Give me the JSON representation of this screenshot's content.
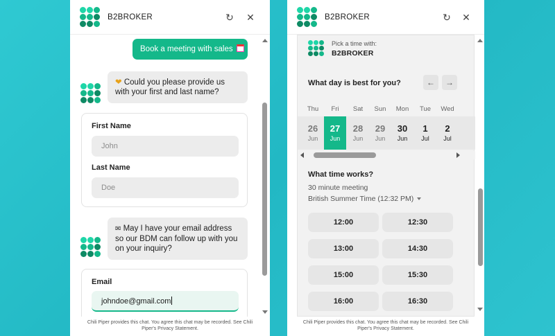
{
  "brand": {
    "name": "B2BROKER",
    "accent": "#14b88a",
    "logo_colors": [
      "#1fd6a8",
      "#14b88a",
      "#0e8a64"
    ]
  },
  "left_panel": {
    "header_title": "B2BROKER",
    "refresh_icon": "refresh-icon",
    "close_icon": "close-icon",
    "user_message": "Book a meeting with sales",
    "user_message_emoji": "calendar-icon",
    "bot_message_1": "Could you please provide us with your first and last name?",
    "bot_message_1_emoji": "heart-icon",
    "first_name_label": "First Name",
    "first_name_placeholder": "John",
    "last_name_label": "Last Name",
    "last_name_placeholder": "Doe",
    "bot_message_2": "May I have your email address so our BDM can follow up with you on your inquiry?",
    "bot_message_2_emoji": "envelope-icon",
    "email_label": "Email",
    "email_value": "johndoe@gmail.com",
    "footer": "Chili Piper provides this chat. You agree this chat may be recorded. See Chili Piper's Privacy Statement."
  },
  "right_panel": {
    "header_title": "B2BROKER",
    "pick_label": "Pick a time with:",
    "pick_name": "B2BROKER",
    "day_question": "What day is best for you?",
    "prev_icon": "arrow-left-icon",
    "next_icon": "arrow-right-icon",
    "days": [
      {
        "weekday": "Thu",
        "date": "26",
        "month": "Jun",
        "state": "disabled"
      },
      {
        "weekday": "Fri",
        "date": "27",
        "month": "Jun",
        "state": "selected"
      },
      {
        "weekday": "Sat",
        "date": "28",
        "month": "Jun",
        "state": "disabled"
      },
      {
        "weekday": "Sun",
        "date": "29",
        "month": "Jun",
        "state": "disabled"
      },
      {
        "weekday": "Mon",
        "date": "30",
        "month": "Jun",
        "state": "available"
      },
      {
        "weekday": "Tue",
        "date": "1",
        "month": "Jul",
        "state": "available"
      },
      {
        "weekday": "Wed",
        "date": "2",
        "month": "Jul",
        "state": "available"
      }
    ],
    "time_question": "What time works?",
    "duration": "30 minute meeting",
    "timezone": "British Summer Time (12:32 PM)",
    "slots": [
      "12:00",
      "12:30",
      "13:00",
      "14:30",
      "15:00",
      "15:30",
      "16:00",
      "16:30"
    ],
    "footer": "Chili Piper provides this chat. You agree this chat may be recorded. See Chili Piper's Privacy Statement."
  }
}
